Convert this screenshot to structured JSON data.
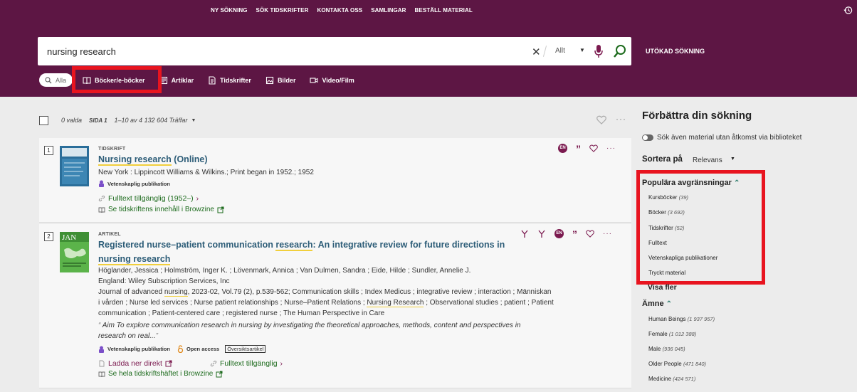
{
  "topnav": [
    "NY SÖKNING",
    "SÖK TIDSKRIFTER",
    "KONTAKTA OSS",
    "SAMLINGAR",
    "BESTÄLL MATERIAL"
  ],
  "search": {
    "query": "nursing research",
    "scope": "Allt"
  },
  "advanced_label": "UTÖKAD SÖKNING",
  "types": {
    "all": "Alla",
    "books": "Böcker/e-böcker",
    "articles": "Artiklar",
    "journals": "Tidskrifter",
    "images": "Bilder",
    "video": "Video/Film"
  },
  "toolbar": {
    "selected": "0 valda",
    "page": "SIDA 1",
    "hits": "1–10 av 4 132 604 Träffar"
  },
  "results": [
    {
      "num": "1",
      "kind": "TIDSKRIFT",
      "title_hl": "Nursing research",
      "title_rest": " (Online)",
      "publisher": "New York : Lippincott Williams & Wilkins.; Print began in 1952.; 1952",
      "peer_badge": "Vetenskaplig publikation",
      "fulltext": "Fulltext tillgänglig (1952–)",
      "browzine": "Se tidskriftens innehåll i Browzine",
      "lang": "EN"
    },
    {
      "num": "2",
      "kind": "ARTIKEL",
      "title_a": "Registered nurse–patient communication ",
      "title_hl1": "research",
      "title_b": ": An integrative review for future directions in",
      "title_hl2": "nursing research",
      "authors": "Höglander, Jessica ; Holmström, Inger K. ; Lövenmark, Annica ; Van Dulmen, Sandra ; Eide, Hilde ; Sundler, Annelie J.",
      "publisher": "England: Wiley Subscription Services, Inc",
      "journal_a": "Journal of advanced ",
      "journal_hl": "nursing",
      "journal_b": ", 2023-02, Vol.79 (2), p.539-562; Communication skills ; Index Medicus ; integrative review ; interaction ; Människan",
      "subjects2_a": "i vården ; Nurse led services ; Nurse patient relationships ; Nurse–Patient Relations ; ",
      "subjects2_hl": "Nursing Research",
      "subjects2_b": " ; Observational studies ; patient ; Patient",
      "subjects3": "communication ; Patient-centered care ; registered nurse ; The Human Perspective in Care",
      "abstract1": "Aim To explore communication research in nursing by investigating the theoretical approaches, methods, content and perspectives in",
      "abstract2": "research on real...",
      "peer_badge": "Vetenskaplig publikation",
      "open_access": "Open access",
      "review_tag": "Översiktsartikel",
      "download": "Ladda ner direkt",
      "fulltext": "Fulltext tillgänglig",
      "browzine": "Se hela tidskriftshäftet i Browzine",
      "lang": "EN",
      "cover_text": "JAN"
    }
  ],
  "sidebar": {
    "title": "Förbättra din sökning",
    "toggle_label": "Sök även material utan åtkomst via biblioteket",
    "sort_label": "Sortera på",
    "sort_value": "Relevans",
    "popular_head": "Populära avgränsningar",
    "popular": [
      {
        "label": "Kursböcker",
        "count": "(39)"
      },
      {
        "label": "Böcker",
        "count": "(3 692)"
      },
      {
        "label": "Tidskrifter",
        "count": "(52)"
      },
      {
        "label": "Fulltext",
        "count": ""
      },
      {
        "label": "Vetenskapliga publikationer",
        "count": ""
      },
      {
        "label": "Tryckt material",
        "count": ""
      }
    ],
    "show_more": "Visa fler",
    "subject_head": "Ämne",
    "subjects": [
      {
        "label": "Human Beings",
        "count": "(1 937 957)"
      },
      {
        "label": "Female",
        "count": "(1 012 388)"
      },
      {
        "label": "Male",
        "count": "(936 045)"
      },
      {
        "label": "Older People",
        "count": "(471 840)"
      },
      {
        "label": "Medicine",
        "count": "(424 571)"
      }
    ]
  },
  "colors": {
    "header": "#5d1644",
    "accent": "#7b1a4f",
    "link_green": "#1d6b1d",
    "title_blue": "#2d5d78",
    "highlight": "#f1cf3c",
    "annotation_red": "#e8141f"
  }
}
